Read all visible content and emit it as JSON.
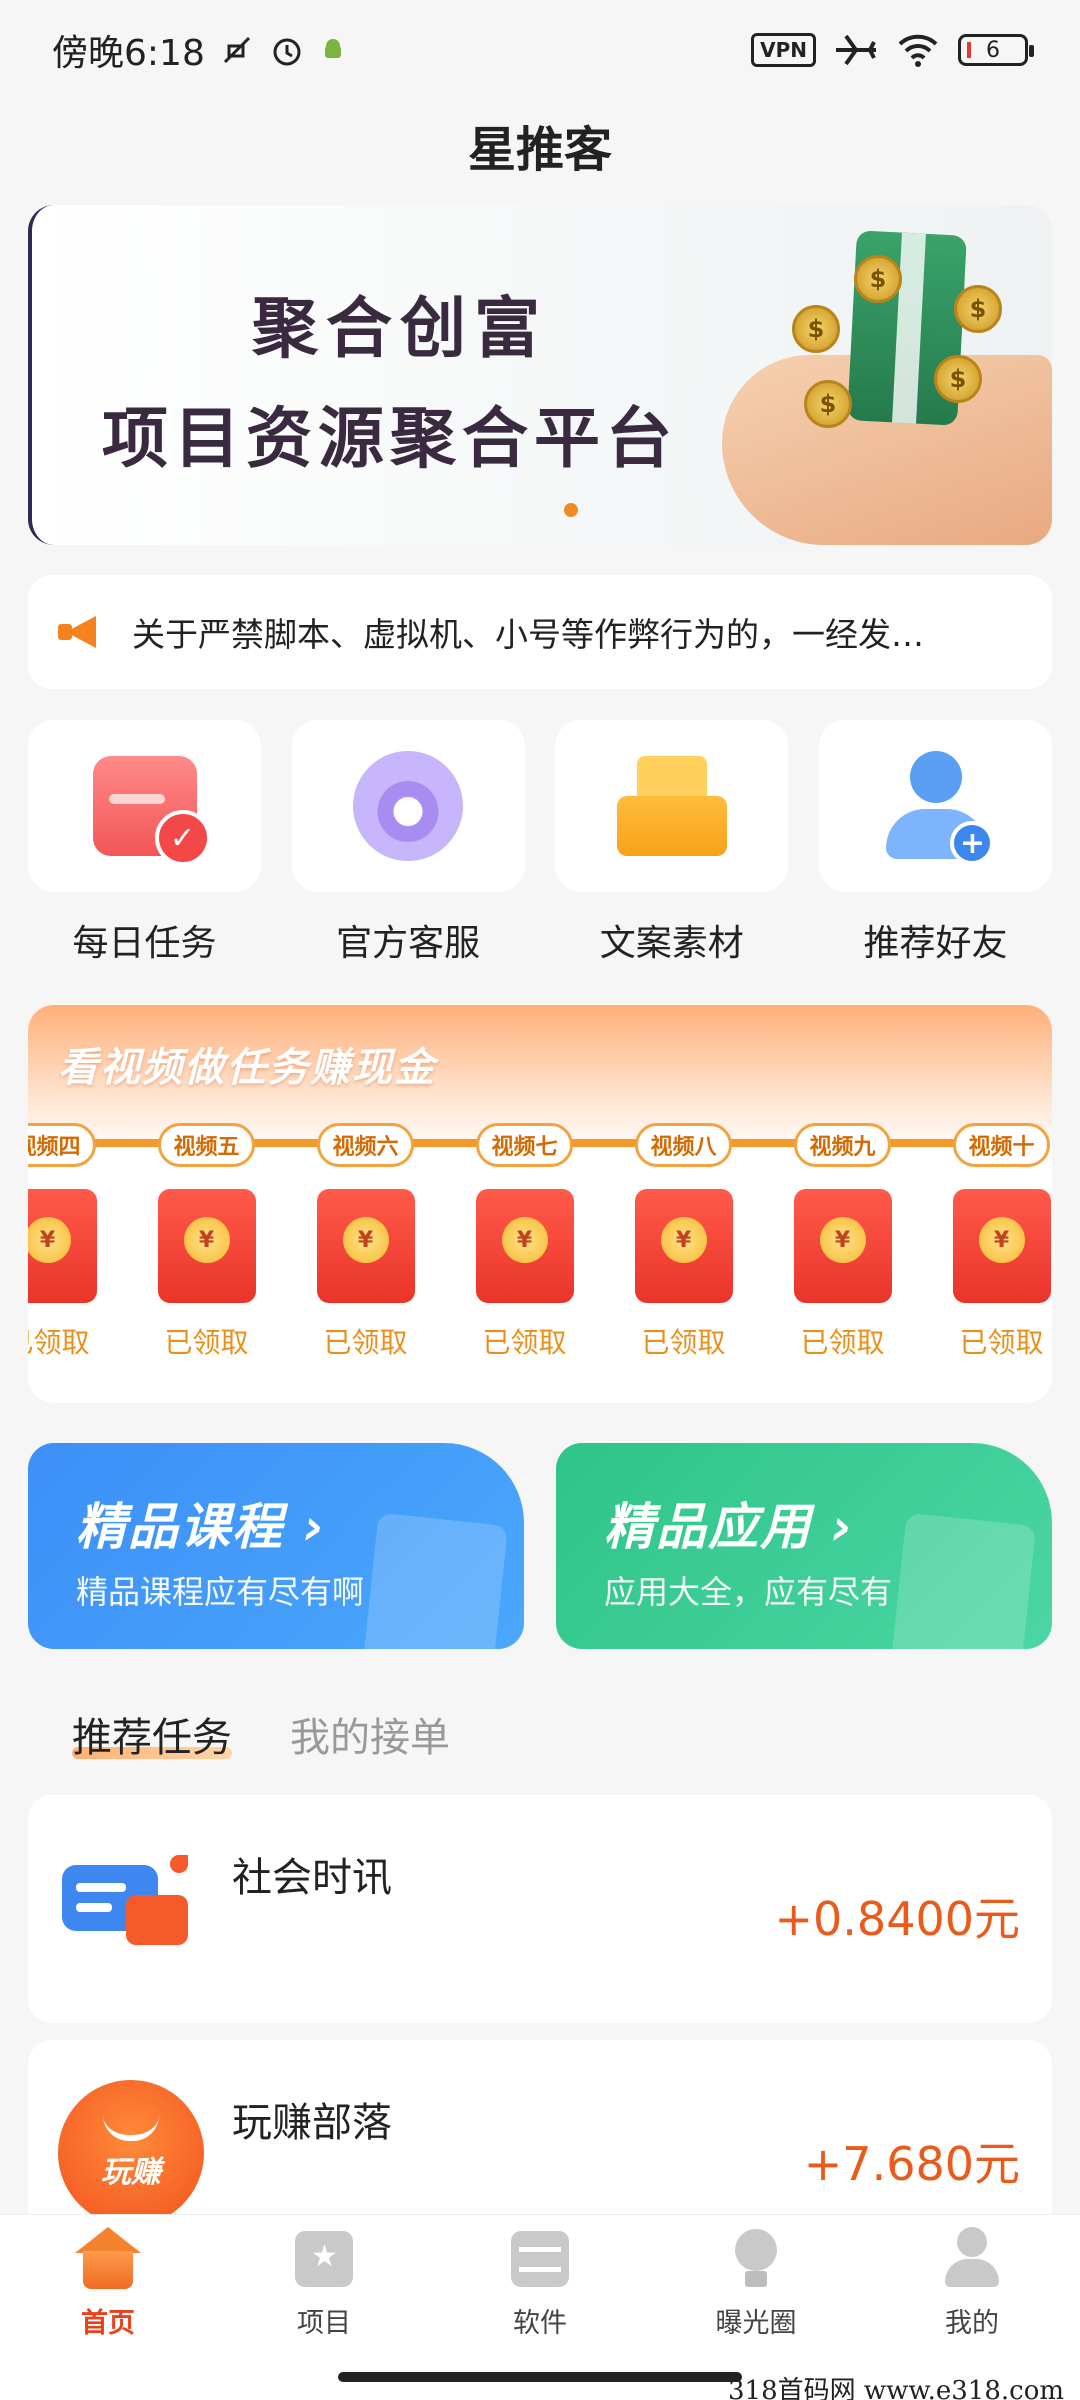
{
  "status_bar": {
    "time": "傍晚6:18",
    "vpn_label": "VPN",
    "battery_level": "6",
    "icons": [
      "mute-icon",
      "alarm-icon",
      "android-icon",
      "vpn-icon",
      "airplane-icon",
      "wifi-icon",
      "battery-icon"
    ]
  },
  "header": {
    "title": "星推客"
  },
  "banner": {
    "line1": "聚合创富",
    "line2": "项目资源聚合平台",
    "coin_symbol": "$",
    "indicator_color": "#f08a24"
  },
  "notice": {
    "text": "关于严禁脚本、虚拟机、小号等作弊行为的，一经发…"
  },
  "quick_actions": [
    {
      "label": "每日任务",
      "icon": "calendar-check-icon"
    },
    {
      "label": "官方客服",
      "icon": "customer-service-icon"
    },
    {
      "label": "文案素材",
      "icon": "envelope-document-icon"
    },
    {
      "label": "推荐好友",
      "icon": "add-user-icon"
    }
  ],
  "video_tasks": {
    "title": "看视频做任务赚现金",
    "items": [
      {
        "label": "视频四",
        "status": "已领取"
      },
      {
        "label": "视频五",
        "status": "已领取"
      },
      {
        "label": "视频六",
        "status": "已领取"
      },
      {
        "label": "视频七",
        "status": "已领取"
      },
      {
        "label": "视频八",
        "status": "已领取"
      },
      {
        "label": "视频九",
        "status": "已领取"
      },
      {
        "label": "视频十",
        "status": "已领取"
      }
    ],
    "yuan_symbol": "¥"
  },
  "promos": {
    "course": {
      "title": "精品课程",
      "arrow": "›",
      "subtitle": "精品课程应有尽有啊"
    },
    "apps": {
      "title": "精品应用",
      "arrow": "›",
      "subtitle": "应用大全，应有尽有"
    }
  },
  "tabs": [
    {
      "label": "推荐任务",
      "active": true
    },
    {
      "label": "我的接单",
      "active": false
    }
  ],
  "tasks": [
    {
      "name": "社会时讯",
      "reward": "+0.8400元",
      "icon": "news-chat-icon"
    },
    {
      "name": "玩赚部落",
      "reward": "+7.680元",
      "icon": "wanzhuan-logo-icon",
      "logo_text": "玩赚"
    }
  ],
  "bottom_nav": [
    {
      "label": "首页",
      "icon": "home-icon",
      "active": true
    },
    {
      "label": "项目",
      "icon": "project-star-icon",
      "active": false
    },
    {
      "label": "软件",
      "icon": "software-drawer-icon",
      "active": false
    },
    {
      "label": "曝光圈",
      "icon": "lightbulb-icon",
      "active": false
    },
    {
      "label": "我的",
      "icon": "profile-icon",
      "active": false
    }
  ],
  "colors": {
    "accent": "#ea5a1a",
    "nav_active": "#e8421c",
    "claimed": "#e9901a"
  },
  "watermark": "318首码网  www.e318.com"
}
